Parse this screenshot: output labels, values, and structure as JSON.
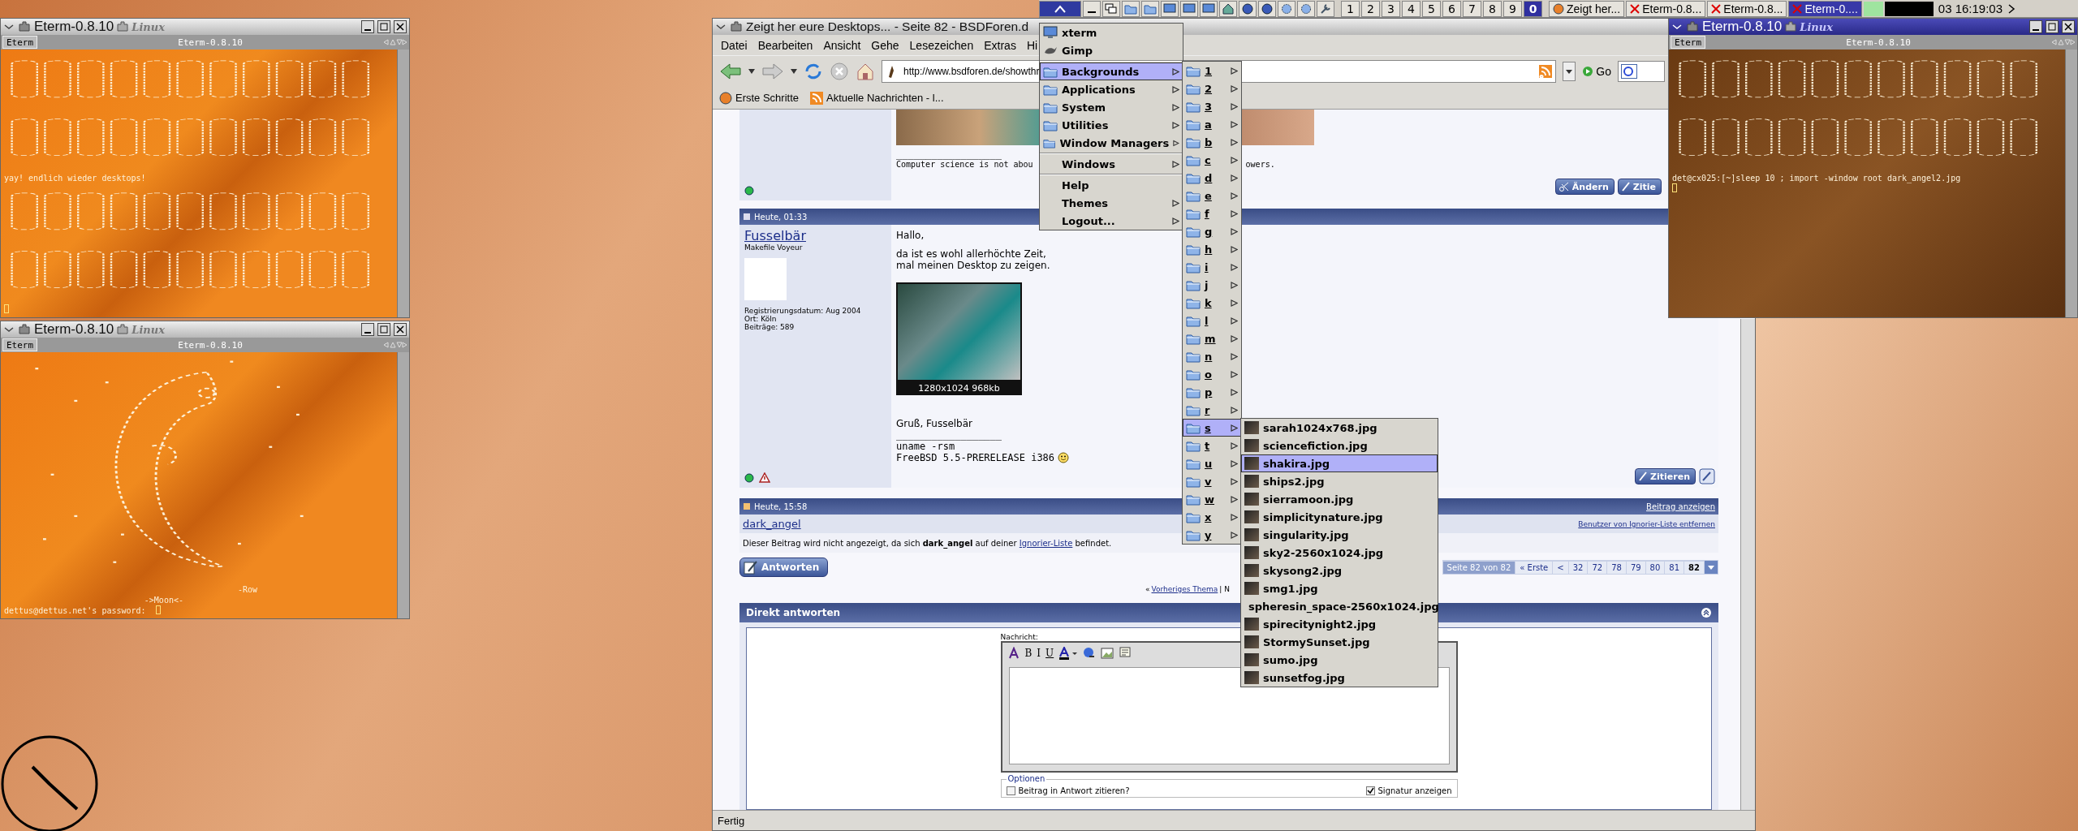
{
  "taskbar": {
    "desktops": [
      {
        "label": "1",
        "selected": false
      },
      {
        "label": "2",
        "selected": false
      },
      {
        "label": "3",
        "selected": false
      },
      {
        "label": "4",
        "selected": false
      },
      {
        "label": "5",
        "selected": false
      },
      {
        "label": "6",
        "selected": false
      },
      {
        "label": "7",
        "selected": false
      },
      {
        "label": "8",
        "selected": false
      },
      {
        "label": "9",
        "selected": false
      },
      {
        "label": "0",
        "selected": true
      }
    ],
    "tasks": [
      {
        "label": "Zeigt her...",
        "kind": "browser",
        "selected": false
      },
      {
        "label": "Eterm-0.8...",
        "kind": "terminal",
        "selected": false
      },
      {
        "label": "Eterm-0.8...",
        "kind": "terminal",
        "selected": false
      },
      {
        "label": "Eterm-0....",
        "kind": "terminal",
        "selected": true
      }
    ],
    "clock": "03 16:19:03"
  },
  "terminals": [
    {
      "title": "Eterm-0.8.10",
      "logo": "Linux",
      "tab": "Eterm",
      "tab_title": "Eterm-0.8.10",
      "active": false,
      "lines": [
        {
          "kind": "banner-art"
        },
        {
          "kind": "text",
          "text": "yay! endlich wieder desktops!"
        },
        {
          "kind": "banner-art"
        },
        {
          "kind": "cursor"
        }
      ]
    },
    {
      "title": "Eterm-0.8.10",
      "logo": "Linux",
      "tab": "Eterm",
      "tab_title": "Eterm-0.8.10",
      "active": false,
      "lines": [
        {
          "kind": "moon-art"
        },
        {
          "kind": "credit",
          "text": "-Row"
        },
        {
          "kind": "caption",
          "text": "->Moon<-"
        },
        {
          "kind": "text",
          "text": "dettus@dettus.net's password: "
        },
        {
          "kind": "cursor-inline"
        }
      ]
    },
    {
      "title": "Eterm-0.8.10",
      "logo": "Linux",
      "tab": "Eterm",
      "tab_title": "Eterm-0.8.10",
      "active": true,
      "lines": [
        {
          "kind": "banner-art"
        },
        {
          "kind": "text",
          "text": "det@cx025:[~]sleep 10 ; import -window root dark_angel2.jpg"
        },
        {
          "kind": "cursor"
        },
        {
          "kind": "blank"
        }
      ]
    }
  ],
  "browser": {
    "title": "Zeigt her eure Desktops... - Seite 82 - BSDForen.d",
    "menu": [
      "Datei",
      "Bearbeiten",
      "Ansicht",
      "Gehe",
      "Lesezeichen",
      "Extras",
      "Hi"
    ],
    "url": "http://www.bsdforen.de/showthr",
    "go": "Go",
    "bookmarks": [
      "Erste Schritte",
      "Aktuelle Nachrichten - l..."
    ],
    "previous_post": {
      "signature_rule": "__________________",
      "signature": "Computer science is not abou",
      "signature_end": "owers.",
      "buttons": [
        "Ändern",
        "Zitie"
      ]
    },
    "post": {
      "date": "Heute, 01:33",
      "author": "Fusselbär",
      "rank": "Makefile Voyeur",
      "info": [
        "Registrierungsdatum: Aug 2004",
        "Ort: Köln",
        "Beiträge: 589"
      ],
      "body": [
        "Hallo,",
        "da ist es wohl allerhöchte Zeit,",
        "mal meinen Desktop zu zeigen."
      ],
      "image_caption": "1280x1024 968kb",
      "greeting": "Gruß, Fusselbär",
      "signature_rule": "__________________",
      "signature": [
        "uname -rsm",
        "FreeBSD 5.5-PRERELEASE i386"
      ],
      "button": "Zitieren"
    },
    "ignored_post": {
      "date": "Heute, 15:58",
      "show_link": "Beitrag anzeigen",
      "author": "dark_angel",
      "remove_link": "Benutzer von Ignorier-Liste entfernen",
      "message": "Dieser Beitrag wird nicht angezeigt, da sich **dark_angel** auf deiner ",
      "message_link": "Ignorier-Liste",
      "message_end": " befindet."
    },
    "reply_button": "Antworten",
    "pagination": {
      "label": "Seite 82 von 82",
      "first": "« Erste",
      "prev": "<",
      "pages": [
        {
          "label": "32",
          "selected": false
        },
        {
          "label": "72",
          "selected": false
        },
        {
          "label": "78",
          "selected": false
        },
        {
          "label": "79",
          "selected": false
        },
        {
          "label": "80",
          "selected": false
        },
        {
          "label": "81",
          "selected": false
        },
        {
          "label": "82",
          "selected": true
        }
      ]
    },
    "thread_nav": {
      "prefix": "«",
      "previous": "Vorheriges Thema",
      "rest": "| N"
    },
    "quick_reply": {
      "title": "Direkt antworten",
      "message_label": "Nachricht:",
      "format_buttons": [
        "B",
        "I",
        "U"
      ],
      "options_legend": "Optionen",
      "options": [
        {
          "label": "Beitrag in Antwort zitieren?",
          "checked": false
        },
        {
          "label": "Signatur anzeigen",
          "checked": true
        }
      ]
    },
    "status": "Fertig"
  },
  "menus": {
    "root": [
      {
        "label": "xterm",
        "kind": "terminal",
        "selected": false,
        "submenu": false
      },
      {
        "label": "Gimp",
        "kind": "app",
        "selected": false,
        "submenu": false
      },
      {
        "kind": "separator"
      },
      {
        "label": "Backgrounds",
        "kind": "folder",
        "selected": true,
        "submenu": true
      },
      {
        "label": "Applications",
        "kind": "folder",
        "selected": false,
        "submenu": true
      },
      {
        "label": "System",
        "kind": "folder",
        "selected": false,
        "submenu": true
      },
      {
        "label": "Utilities",
        "kind": "folder",
        "selected": false,
        "submenu": true
      },
      {
        "label": "Window Managers",
        "kind": "folder",
        "selected": false,
        "submenu": true
      },
      {
        "kind": "separator"
      },
      {
        "label": "Windows",
        "kind": "plain",
        "selected": false,
        "submenu": true
      },
      {
        "kind": "separator"
      },
      {
        "label": "Help",
        "kind": "plain",
        "selected": false,
        "submenu": false
      },
      {
        "label": "Themes",
        "kind": "plain",
        "selected": false,
        "submenu": true
      },
      {
        "label": "Logout...",
        "kind": "plain",
        "selected": false,
        "submenu": true
      }
    ],
    "backgrounds": [
      {
        "label": "1",
        "selected": false
      },
      {
        "label": "2",
        "selected": false
      },
      {
        "label": "3",
        "selected": false
      },
      {
        "label": "a",
        "selected": false
      },
      {
        "label": "b",
        "selected": false
      },
      {
        "label": "c",
        "selected": false
      },
      {
        "label": "d",
        "selected": false
      },
      {
        "label": "e",
        "selected": false
      },
      {
        "label": "f",
        "selected": false
      },
      {
        "label": "g",
        "selected": false
      },
      {
        "label": "h",
        "selected": false
      },
      {
        "label": "i",
        "selected": false
      },
      {
        "label": "j",
        "selected": false
      },
      {
        "label": "k",
        "selected": false
      },
      {
        "label": "l",
        "selected": false
      },
      {
        "label": "m",
        "selected": false
      },
      {
        "label": "n",
        "selected": false
      },
      {
        "label": "o",
        "selected": false
      },
      {
        "label": "p",
        "selected": false
      },
      {
        "label": "r",
        "selected": false
      },
      {
        "label": "s",
        "selected": true
      },
      {
        "label": "t",
        "selected": false
      },
      {
        "label": "u",
        "selected": false
      },
      {
        "label": "v",
        "selected": false
      },
      {
        "label": "w",
        "selected": false
      },
      {
        "label": "x",
        "selected": false
      },
      {
        "label": "y",
        "selected": false
      }
    ],
    "files": [
      {
        "label": "sarah1024x768.jpg",
        "selected": false
      },
      {
        "label": "sciencefiction.jpg",
        "selected": false
      },
      {
        "label": "shakira.jpg",
        "selected": true
      },
      {
        "label": "ships2.jpg",
        "selected": false
      },
      {
        "label": "sierramoon.jpg",
        "selected": false
      },
      {
        "label": "simplicitynature.jpg",
        "selected": false
      },
      {
        "label": "singularity.jpg",
        "selected": false
      },
      {
        "label": "sky2-2560x1024.jpg",
        "selected": false
      },
      {
        "label": "skysong2.jpg",
        "selected": false
      },
      {
        "label": "smg1.jpg",
        "selected": false
      },
      {
        "label": "spheresin_space-2560x1024.jpg",
        "selected": false
      },
      {
        "label": "spirecitynight2.jpg",
        "selected": false
      },
      {
        "label": "StormySunset.jpg",
        "selected": false
      },
      {
        "label": "sumo.jpg",
        "selected": false
      },
      {
        "label": "sunsetfog.jpg",
        "selected": false
      }
    ]
  }
}
